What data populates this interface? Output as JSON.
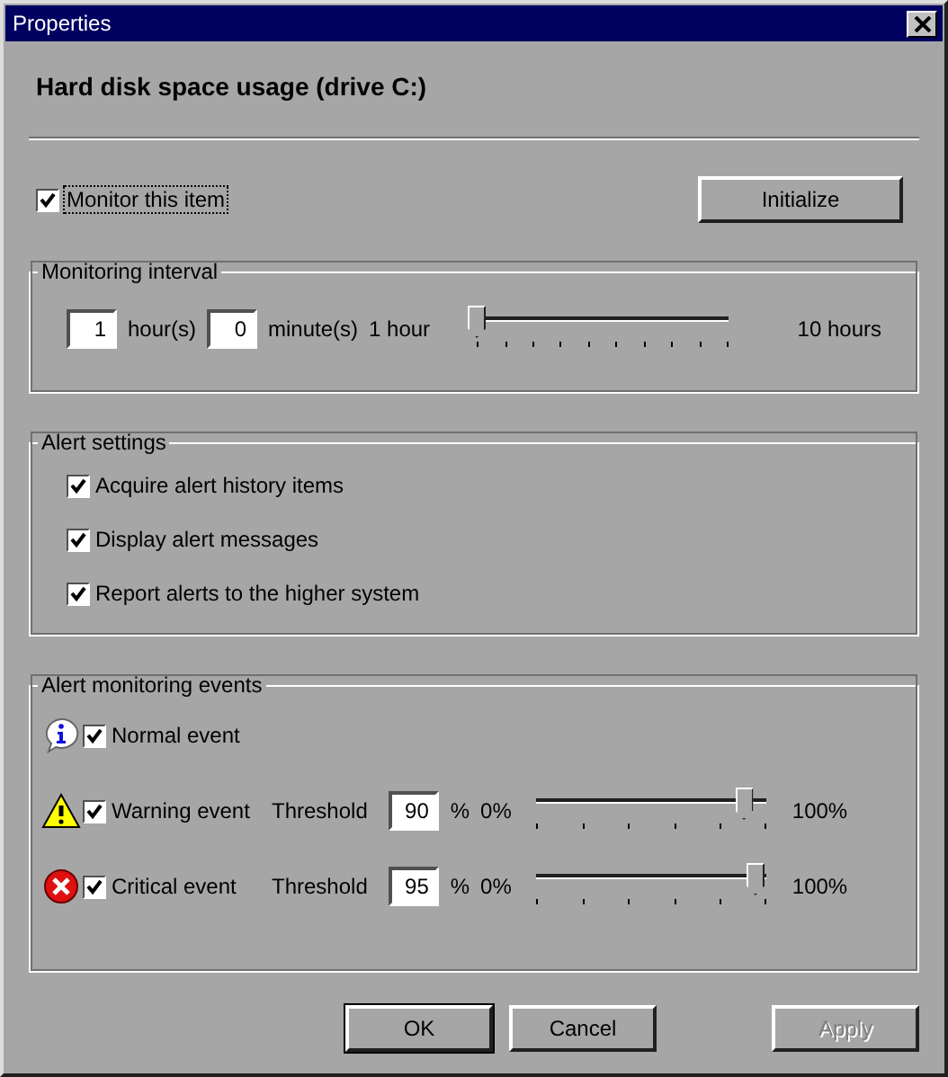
{
  "window": {
    "title": "Properties"
  },
  "heading": "Hard disk space usage (drive C:)",
  "monitor": {
    "label": "Monitor this item",
    "checked": true
  },
  "initialize_button": "Initialize",
  "interval": {
    "title": "Monitoring interval",
    "hours": "1",
    "hours_unit": "hour(s)",
    "minutes": "0",
    "minutes_unit": "minute(s)",
    "min_label": "1 hour",
    "max_label": "10 hours",
    "level": 0
  },
  "alert_settings": {
    "title": "Alert settings",
    "items": [
      {
        "label": "Acquire alert history items",
        "checked": true
      },
      {
        "label": "Display alert messages",
        "checked": true
      },
      {
        "label": "Report alerts to the higher system",
        "checked": true
      }
    ]
  },
  "events": {
    "title": "Alert monitoring events",
    "items": [
      {
        "kind": "info",
        "label": "Normal event",
        "checked": true
      },
      {
        "kind": "warning",
        "label": "Warning event",
        "checked": true,
        "threshold_label": "Threshold",
        "value": "90",
        "unit": "%",
        "min_label": "0%",
        "max_label": "100%",
        "level": 0.9
      },
      {
        "kind": "critical",
        "label": "Critical event",
        "checked": true,
        "threshold_label": "Threshold",
        "value": "95",
        "unit": "%",
        "min_label": "0%",
        "max_label": "100%",
        "level": 0.95
      }
    ]
  },
  "buttons": [
    {
      "label": "OK",
      "disabled": false,
      "default": true
    },
    {
      "label": "Cancel",
      "disabled": false,
      "default": false
    },
    {
      "label": "Apply",
      "disabled": true,
      "default": false
    }
  ]
}
